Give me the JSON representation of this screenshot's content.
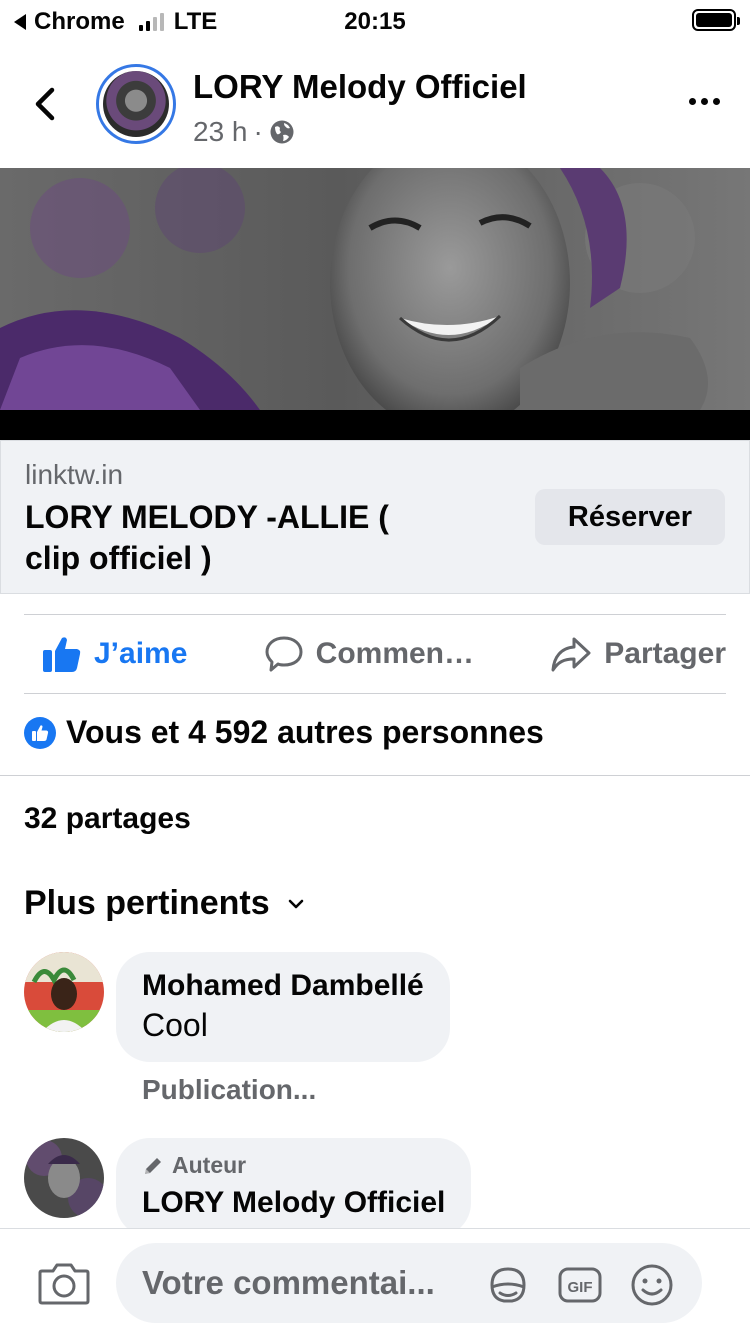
{
  "status_bar": {
    "back_app": "Chrome",
    "network": "LTE",
    "time": "20:15"
  },
  "post": {
    "page_name": "LORY Melody Officiel",
    "time_ago": "23 h",
    "separator": "·"
  },
  "link_preview": {
    "domain": "linktw.in",
    "title": "LORY MELODY -ALLIE ( clip officiel )",
    "button_label": "Réserver"
  },
  "actions": {
    "like": "J’aime",
    "comment": "Commen…",
    "share": "Partager"
  },
  "reactions": {
    "summary": "Vous et 4 592 autres personnes"
  },
  "shares": {
    "label": "32 partages"
  },
  "sort": {
    "label": "Plus pertinents"
  },
  "comments": [
    {
      "author": "Mohamed Dambellé",
      "text": "Cool",
      "sub": "Publication..."
    },
    {
      "badge": "Auteur",
      "author": "LORY Melody Officiel"
    }
  ],
  "composer": {
    "placeholder": "Votre commentai..."
  },
  "colors": {
    "accent": "#1877f2",
    "secondary_text": "#65676b",
    "bubble": "#f0f2f5"
  },
  "icons": [
    "back-chevron-icon",
    "globe-icon",
    "more-icon",
    "like-icon",
    "comment-icon",
    "share-icon",
    "chevron-down-icon",
    "camera-icon",
    "sticker-icon",
    "gif-icon",
    "emoji-icon",
    "pencil-icon"
  ]
}
